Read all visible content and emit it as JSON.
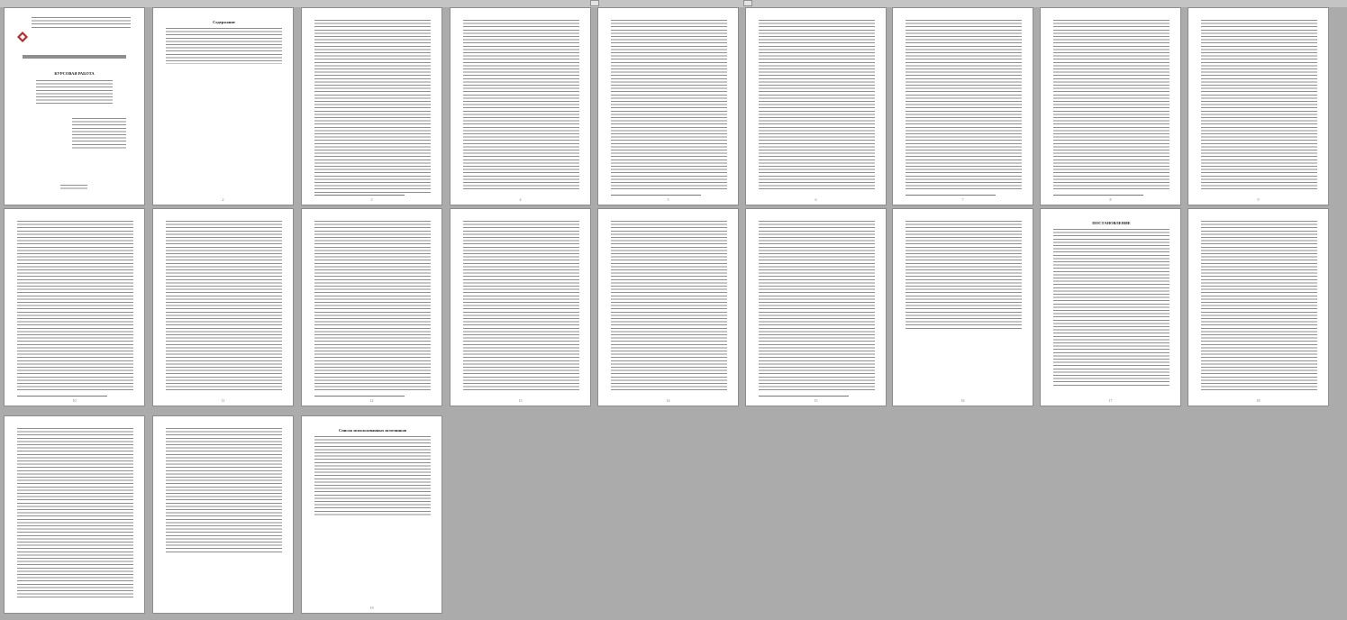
{
  "viewer": {
    "scroll_thumbs": 2
  },
  "cover": {
    "header_line1": "Министерство науки и высшего образования Российской Федерации",
    "header_line2": "«Байкальский государственный университет»",
    "department": "Кафедра уголовного права, уголовного процесса",
    "work_type": "КУРСОВАЯ РАБОТА",
    "city_year": "Иркутск 20__"
  },
  "toc_title": "Содержание",
  "resolution_title": "ПОСТАНОВЛЕНИЕ",
  "sources_title": "Список использованных источников",
  "brand_color": "#b72a2a",
  "pages": [
    {
      "id": "p1",
      "num": ""
    },
    {
      "id": "p2",
      "num": "2"
    },
    {
      "id": "p3",
      "num": "3"
    },
    {
      "id": "p4",
      "num": "4"
    },
    {
      "id": "p5",
      "num": "5"
    },
    {
      "id": "p6",
      "num": "6"
    },
    {
      "id": "p7",
      "num": "7"
    },
    {
      "id": "p8",
      "num": "8"
    },
    {
      "id": "p9",
      "num": "9"
    },
    {
      "id": "p10",
      "num": "10"
    },
    {
      "id": "p11",
      "num": "11"
    },
    {
      "id": "p12",
      "num": "12"
    },
    {
      "id": "p13",
      "num": "13"
    },
    {
      "id": "p14",
      "num": "14"
    },
    {
      "id": "p15",
      "num": "15"
    },
    {
      "id": "p16",
      "num": "16"
    },
    {
      "id": "p17",
      "num": "17"
    },
    {
      "id": "p18",
      "num": "18"
    },
    {
      "id": "p19",
      "num": "19"
    }
  ]
}
